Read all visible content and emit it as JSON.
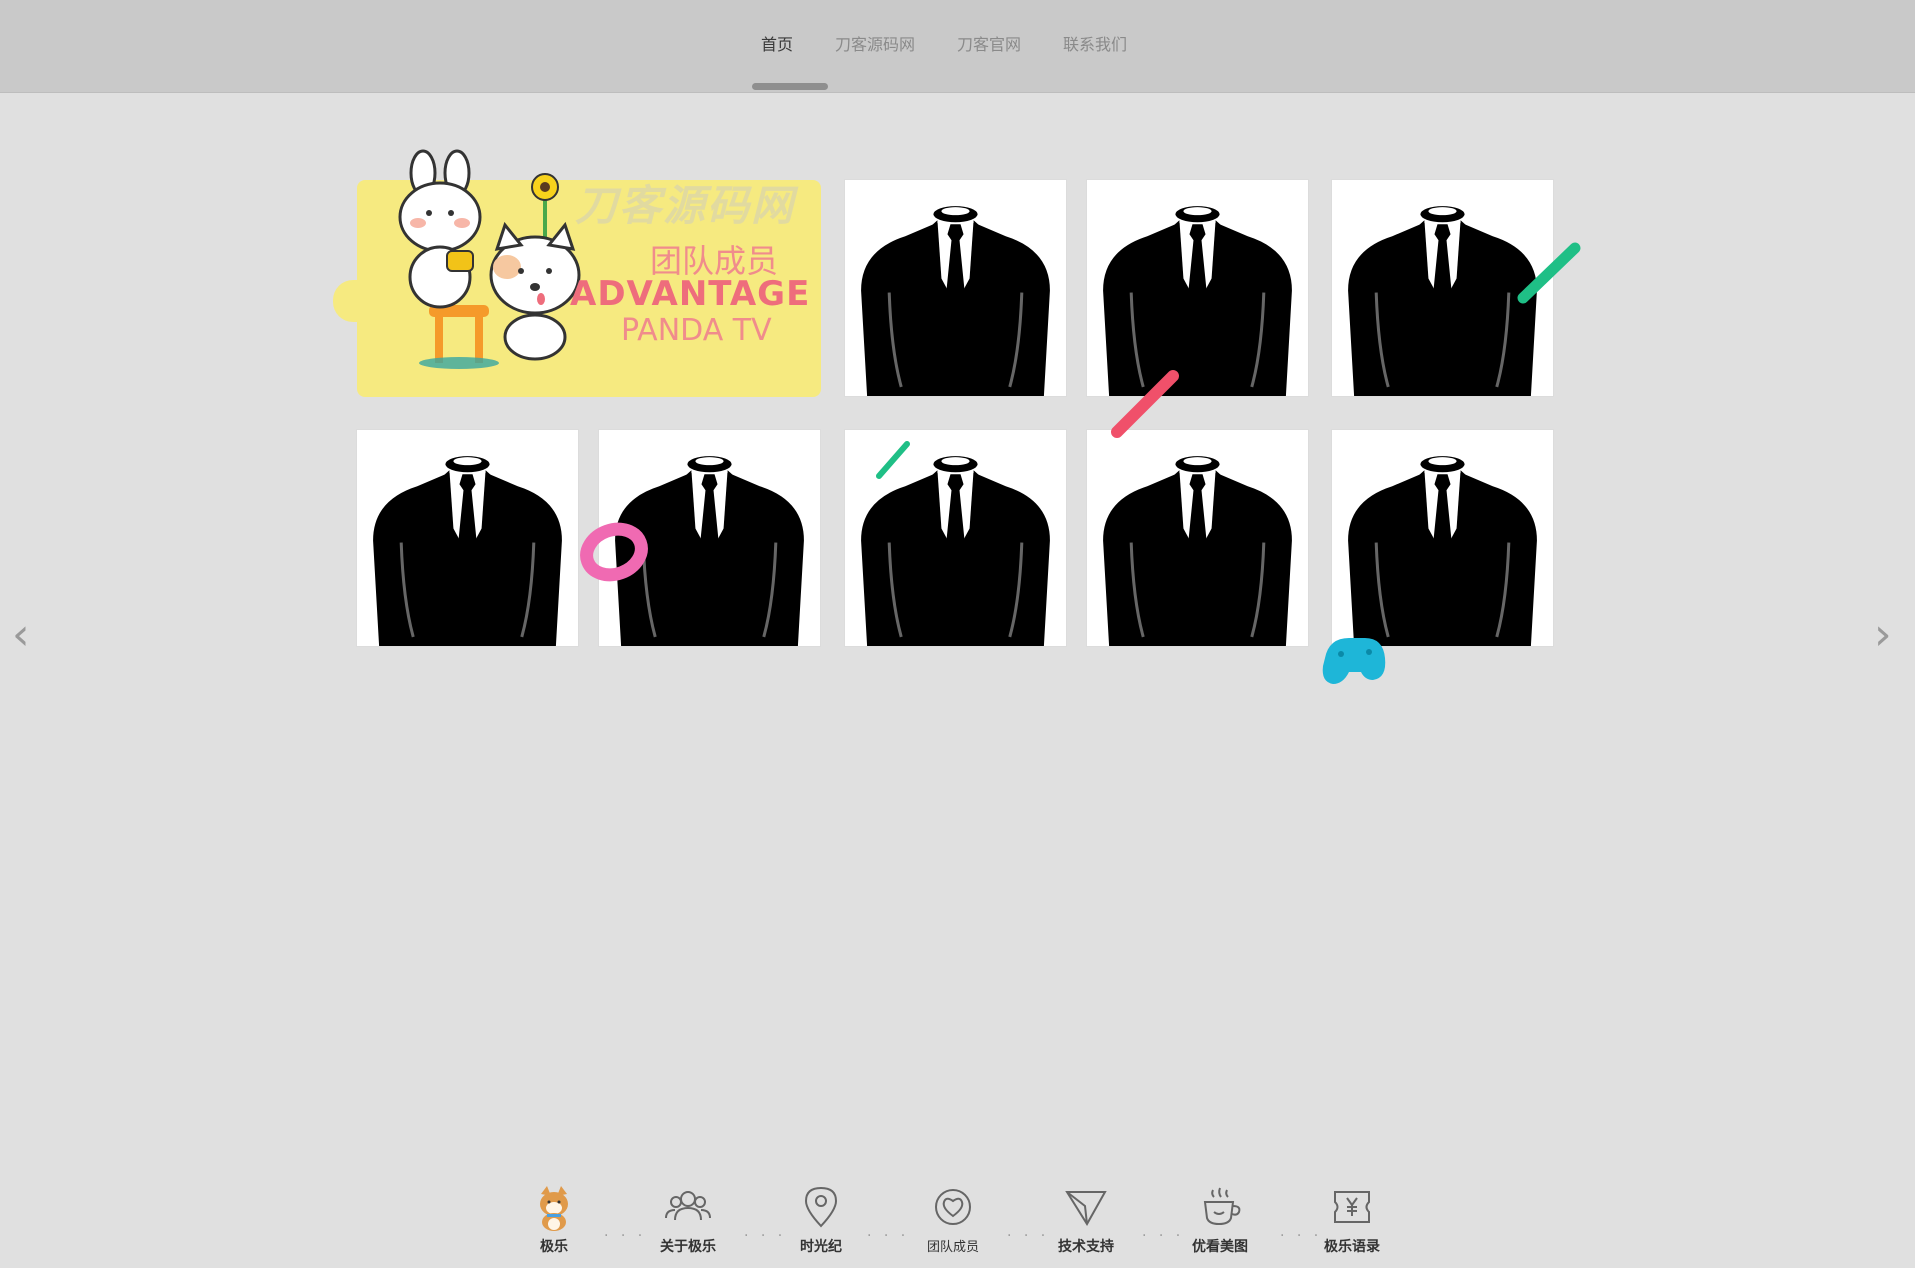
{
  "topnav": {
    "items": [
      {
        "label": "首页",
        "active": true
      },
      {
        "label": "刀客源码网",
        "active": false
      },
      {
        "label": "刀客官网",
        "active": false
      },
      {
        "label": "联系我们",
        "active": false
      }
    ]
  },
  "banner": {
    "watermark": "刀客源码网",
    "title": "团队成员",
    "subtitle": "ADVANTAGE",
    "brand": "PANDA TV",
    "bg_color": "#f6ea80",
    "accent_color": "#ee6d7c"
  },
  "carousel": {
    "prev_icon": "‹",
    "next_icon": "›"
  },
  "bottomnav": {
    "items": [
      {
        "label": "极乐",
        "icon": "shiba-dog-icon"
      },
      {
        "label": "关于极乐",
        "icon": "people-group-icon"
      },
      {
        "label": "时光纪",
        "icon": "location-pin-icon"
      },
      {
        "label": "团队成员",
        "icon": "heart-badge-icon"
      },
      {
        "label": "技术支持",
        "icon": "paper-plane-icon"
      },
      {
        "label": "优看美图",
        "icon": "coffee-cup-icon"
      },
      {
        "label": "极乐语录",
        "icon": "yen-ticket-icon"
      }
    ],
    "separator": "· · ·"
  }
}
